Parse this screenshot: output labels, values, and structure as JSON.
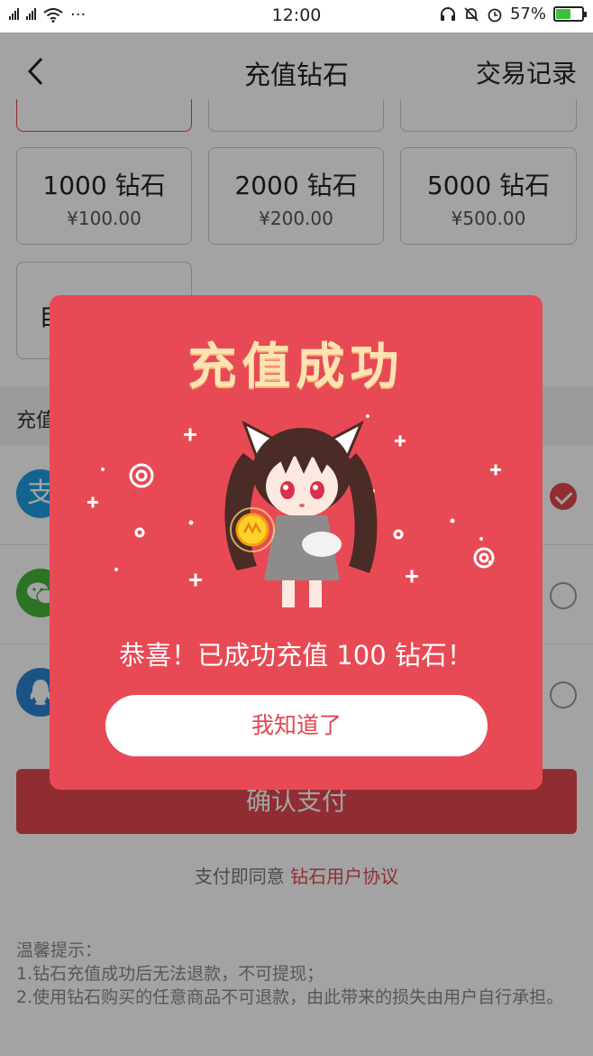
{
  "status_bar": {
    "net_left": "2G",
    "net_right": "4G",
    "more": "···",
    "time": "12:00",
    "battery": "57%",
    "battery_level": 0.57
  },
  "nav": {
    "title": "充值钻石",
    "right_action": "交易记录"
  },
  "packages": [
    {
      "amount": "1000 钻石",
      "price": "¥100.00"
    },
    {
      "amount": "2000 钻石",
      "price": "¥200.00"
    },
    {
      "amount": "5000 钻石",
      "price": "¥500.00"
    }
  ],
  "custom_package": "自",
  "pay_section_title": "充值",
  "pay_methods": [
    {
      "icon": "alipay-icon",
      "glyph": "支",
      "color": "#1e9ee0",
      "checked": true
    },
    {
      "icon": "wechat-icon",
      "glyph": "",
      "color": "#46b43a",
      "checked": false
    },
    {
      "icon": "qq-icon",
      "glyph": "",
      "color": "#2b83d3",
      "checked": false
    }
  ],
  "confirm_button": "确认支付",
  "agreement": {
    "prefix": "支付即同意 ",
    "link": "钻石用户协议"
  },
  "tips": {
    "title": "温馨提示：",
    "line1": "1.钻石充值成功后无法退款，不可提现；",
    "line2": "2.使用钻石购买的任意商品不可退款，由此带来的损失由用户自行承担。"
  },
  "modal": {
    "title": "充值成功",
    "message": "恭喜！已成功充值 100 钻石！",
    "ok_button": "我知道了"
  },
  "colors": {
    "accent": "#e1474f",
    "modal_bg": "#e84a55",
    "modal_title": "#ffe3b3"
  }
}
